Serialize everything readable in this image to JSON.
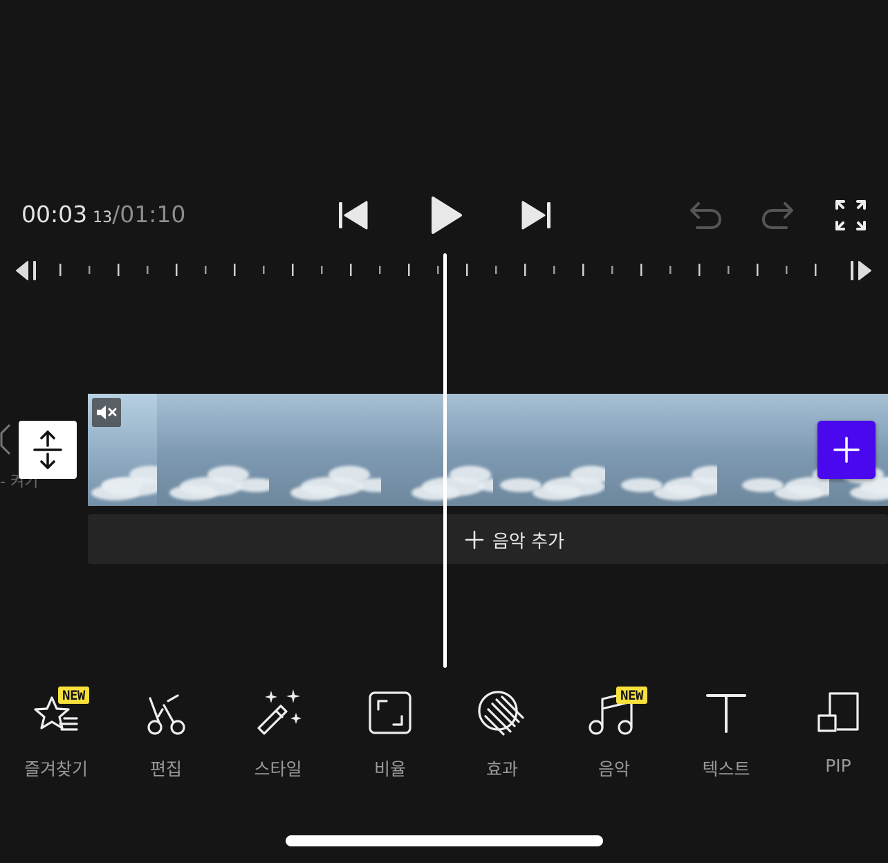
{
  "playback": {
    "current_time": "00:03",
    "current_frames": "13",
    "separator": "/",
    "total_time": "01:10"
  },
  "controls": {
    "skip_back_icon": "skip-to-start-icon",
    "play_icon": "play-icon",
    "skip_forward_icon": "skip-to-end-icon",
    "undo_icon": "undo-icon",
    "redo_icon": "redo-icon",
    "fullscreen_icon": "fullscreen-icon"
  },
  "timeline": {
    "left_stub_text": "- 켜기",
    "music_add_label": "음악 추가",
    "accent_color": "#4a08ee"
  },
  "toolbar": {
    "items": [
      {
        "label": "즐겨찾기",
        "icon": "star-list-icon",
        "badge": "NEW"
      },
      {
        "label": "편집",
        "icon": "scissors-icon"
      },
      {
        "label": "스타일",
        "icon": "magic-wand-icon"
      },
      {
        "label": "비율",
        "icon": "aspect-ratio-icon"
      },
      {
        "label": "효과",
        "icon": "effect-icon"
      },
      {
        "label": "음악",
        "icon": "music-note-icon",
        "badge": "NEW"
      },
      {
        "label": "텍스트",
        "icon": "text-icon"
      },
      {
        "label": "PIP",
        "icon": "pip-icon"
      }
    ]
  }
}
